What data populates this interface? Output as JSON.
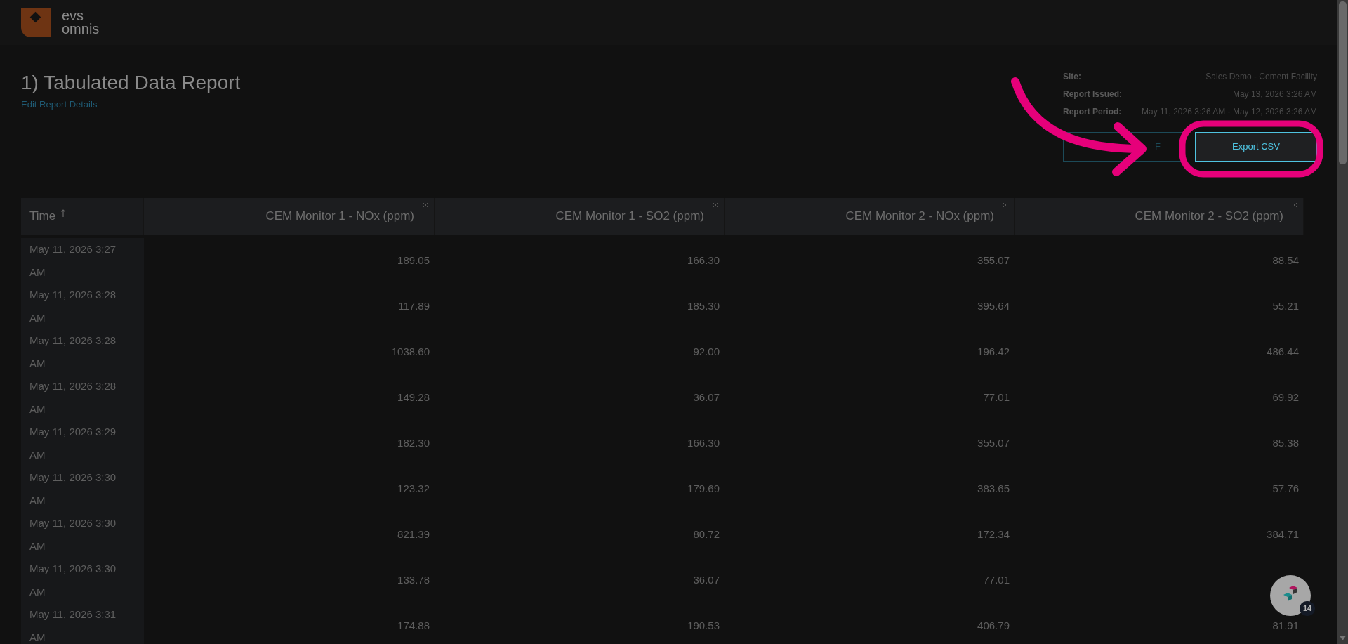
{
  "app": {
    "logo_text": [
      "evs",
      "omnis"
    ]
  },
  "report": {
    "title": "1) Tabulated Data Report",
    "edit_link": "Edit Report Details"
  },
  "details": [
    {
      "label": "Site:",
      "value": "Sales Demo - Cement Facility"
    },
    {
      "label": "Report Issued:",
      "value": "May 13, 2026 3:26 AM"
    },
    {
      "label": "Report Period:",
      "value": "May 11, 2026 3:26 AM - May 12, 2026 3:26 AM"
    }
  ],
  "buttons": [
    {
      "label": "F",
      "kind": "outline"
    },
    {
      "label": "Export CSV",
      "kind": "highlighted"
    }
  ],
  "table": {
    "columns": [
      {
        "label": "Time",
        "sorted": true,
        "removable": false
      },
      {
        "label": "CEM Monitor 1 - NOx (ppm)",
        "sorted": false,
        "removable": true
      },
      {
        "label": "CEM Monitor 1 - SO2 (ppm)",
        "sorted": false,
        "removable": true
      },
      {
        "label": "CEM Monitor 2 - NOx (ppm)",
        "sorted": false,
        "removable": true
      },
      {
        "label": "CEM Monitor 2 - SO2 (ppm)",
        "sorted": false,
        "removable": true
      }
    ],
    "rows": [
      [
        "May 11, 2026 3:27 AM",
        "189.05",
        "166.30",
        "355.07",
        "88.54"
      ],
      [
        "May 11, 2026 3:28 AM",
        "117.89",
        "185.30",
        "395.64",
        "55.21"
      ],
      [
        "May 11, 2026 3:28 AM",
        "1038.60",
        "92.00",
        "196.42",
        "486.44"
      ],
      [
        "May 11, 2026 3:28 AM",
        "149.28",
        "36.07",
        "77.01",
        "69.92"
      ],
      [
        "May 11, 2026 3:29 AM",
        "182.30",
        "166.30",
        "355.07",
        "85.38"
      ],
      [
        "May 11, 2026 3:30 AM",
        "123.32",
        "179.69",
        "383.65",
        "57.76"
      ],
      [
        "May 11, 2026 3:30 AM",
        "821.39",
        "80.72",
        "172.34",
        "384.71"
      ],
      [
        "May 11, 2026 3:30 AM",
        "133.78",
        "36.07",
        "77.01",
        null
      ],
      [
        "May 11, 2026 3:31 AM",
        "174.88",
        "190.53",
        "406.79",
        "81.91"
      ]
    ]
  },
  "help_widget": {
    "count": "14"
  }
}
